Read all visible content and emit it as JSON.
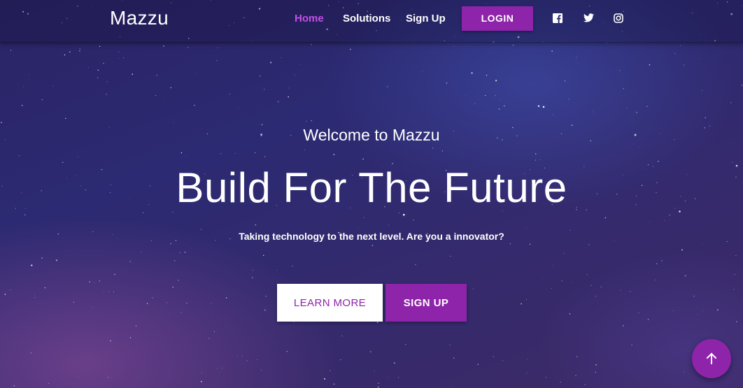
{
  "colors": {
    "accent": "#8e24aa",
    "active_link": "#c54fe8",
    "text": "#ffffff"
  },
  "navbar": {
    "brand": "Mazzu",
    "links": [
      {
        "label": "Home",
        "active": true
      },
      {
        "label": "Solutions",
        "active": false
      },
      {
        "label": "Sign Up",
        "active": false
      }
    ],
    "login_label": "LOGIN",
    "social_icons": [
      "facebook-icon",
      "twitter-icon",
      "instagram-icon"
    ]
  },
  "hero": {
    "welcome": "Welcome to Mazzu",
    "headline": "Build For The Future",
    "tagline": "Taking technology to the next level. Are you a innovator?",
    "learn_more_label": "LEARN MORE",
    "sign_up_label": "SIGN UP"
  },
  "scroll_top": {
    "icon": "arrow-up-icon"
  }
}
